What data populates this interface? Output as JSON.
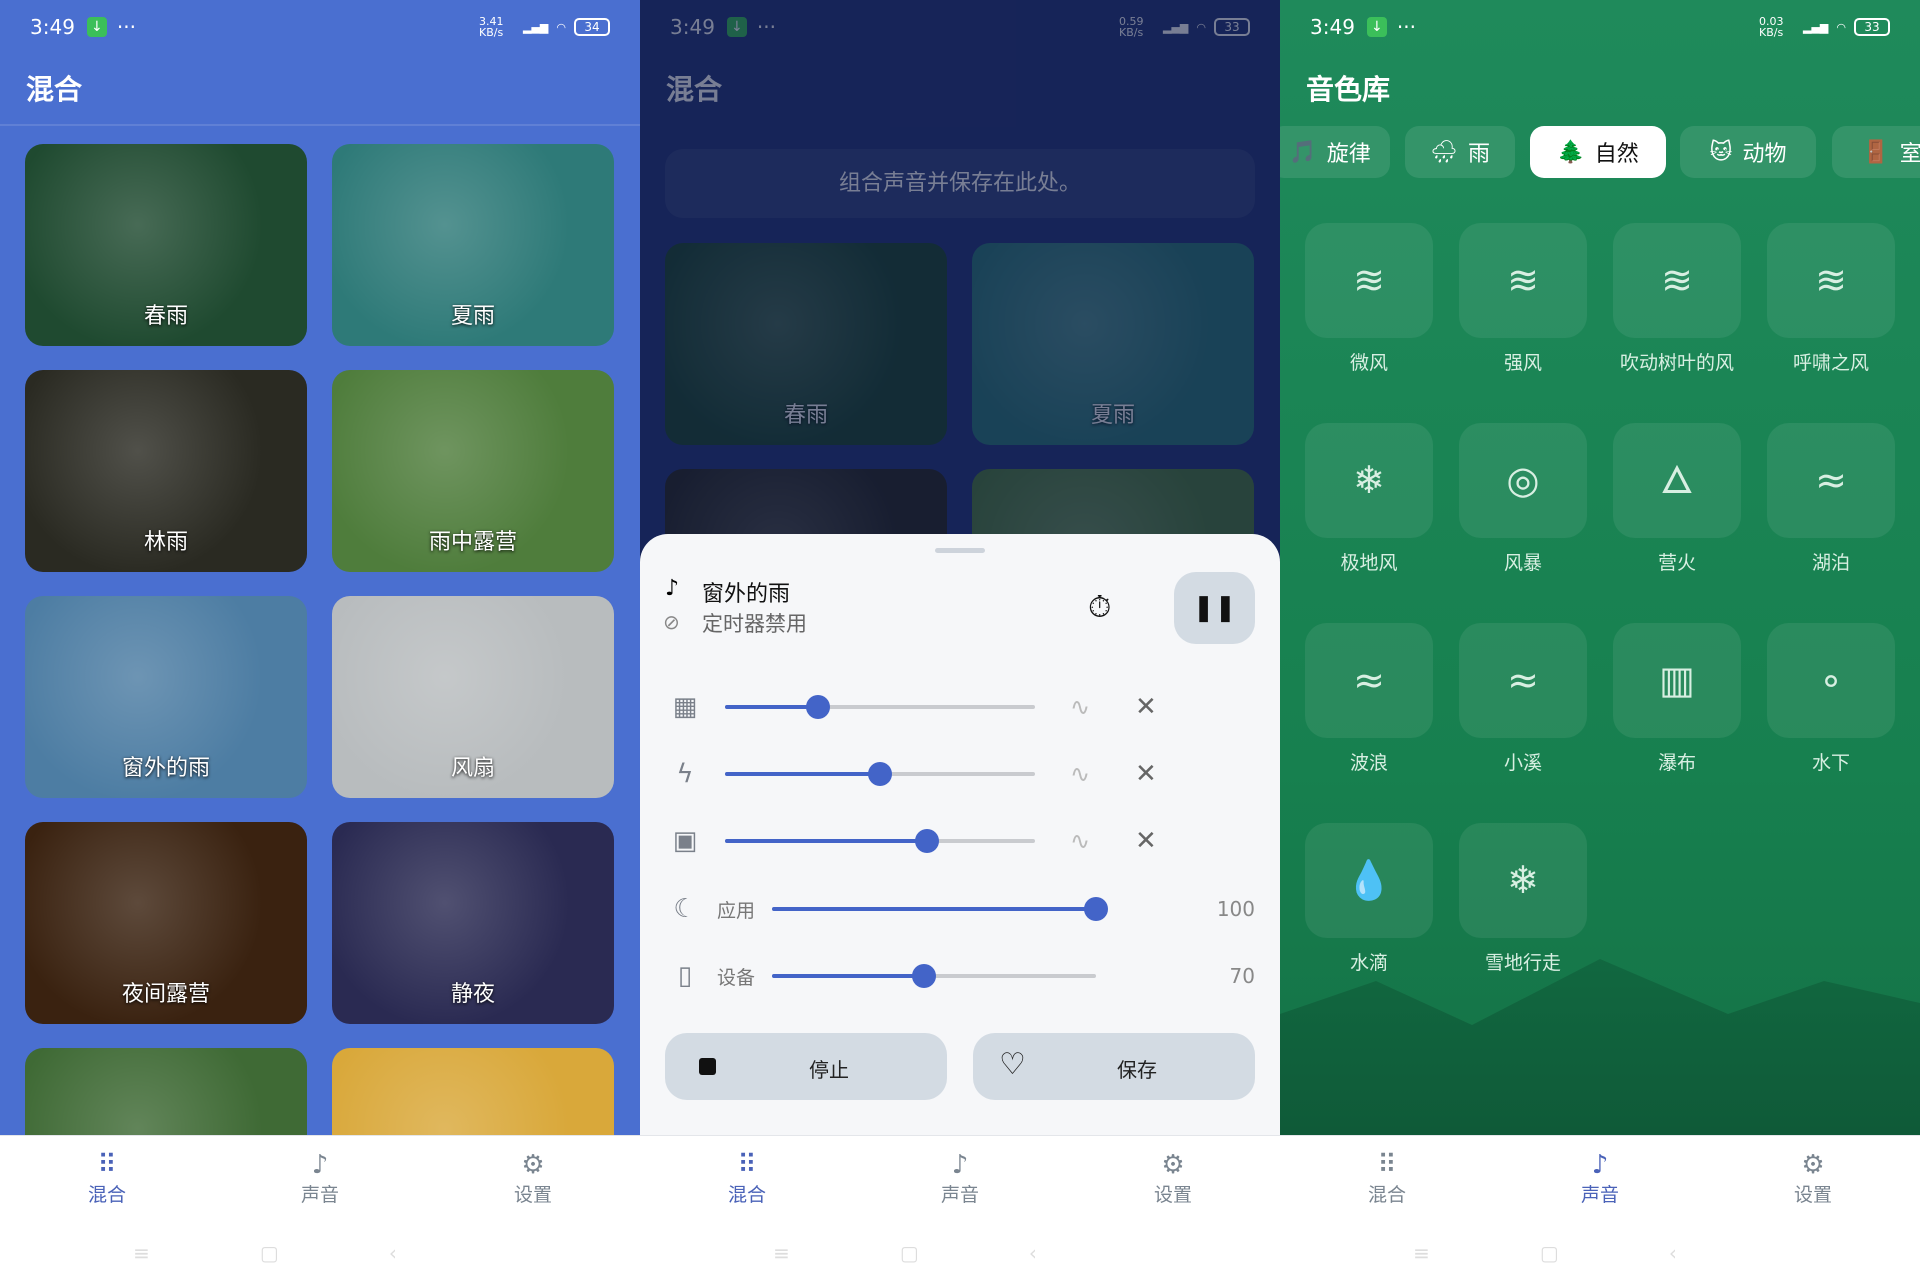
{
  "panel1": {
    "status": {
      "time": "3:49",
      "speed": "3.41 KB/s",
      "battery": "34"
    },
    "title": "混合",
    "cards": [
      {
        "label": "春雨",
        "bg": "#1f4a30"
      },
      {
        "label": "夏雨",
        "bg": "#2e7a78"
      },
      {
        "label": "林雨",
        "bg": "#2a2a22"
      },
      {
        "label": "雨中露营",
        "bg": "#4f7d3c"
      },
      {
        "label": "窗外的雨",
        "bg": "#4d7da3"
      },
      {
        "label": "风扇",
        "bg": "#b8bcbe"
      },
      {
        "label": "夜间露营",
        "bg": "#3a2210"
      },
      {
        "label": "静夜",
        "bg": "#2a2a52"
      },
      {
        "label": "",
        "bg": "#3f6a35"
      },
      {
        "label": "",
        "bg": "#d9a83a"
      }
    ]
  },
  "panel2": {
    "status": {
      "time": "3:49",
      "speed": "0.59 KB/s",
      "battery": "33"
    },
    "title": "混合",
    "placeholder": "组合声音并保存在此处。",
    "cards": [
      {
        "label": "春雨",
        "bg": "#1f4a30"
      },
      {
        "label": "夏雨",
        "bg": "#2e7a78"
      },
      {
        "label": "",
        "bg": "#2a2a22"
      },
      {
        "label": "",
        "bg": "#4f7d3c"
      }
    ],
    "sheet": {
      "title": "窗外的雨",
      "timer_status": "定时器禁用",
      "sounds": [
        {
          "icon": "window-icon",
          "glyph": "▦",
          "level": 0.3
        },
        {
          "icon": "lightning-icon",
          "glyph": "ϟ",
          "level": 0.5
        },
        {
          "icon": "fireplace-icon",
          "glyph": "▣",
          "level": 0.65
        }
      ],
      "app_volume": {
        "label": "应用",
        "value": "100",
        "level": 1.0
      },
      "device_volume": {
        "label": "设备",
        "value": "70",
        "level": 0.47
      },
      "stop_label": "停止",
      "save_label": "保存"
    }
  },
  "panel3": {
    "status": {
      "time": "3:49",
      "speed": "0.03 KB/s",
      "battery": "33"
    },
    "title": "音色库",
    "chips": [
      {
        "emoji": "🎵",
        "label": "旋律"
      },
      {
        "emoji": "🌧",
        "label": "雨"
      },
      {
        "emoji": "🌲",
        "label": "自然",
        "active": true
      },
      {
        "emoji": "🐱",
        "label": "动物"
      },
      {
        "emoji": "🚪",
        "label": "室"
      }
    ],
    "sounds": [
      {
        "label": "微风",
        "glyph": "≋"
      },
      {
        "label": "强风",
        "glyph": "≋"
      },
      {
        "label": "吹动树叶的风",
        "glyph": "≋"
      },
      {
        "label": "呼啸之风",
        "glyph": "≋"
      },
      {
        "label": "极地风",
        "glyph": "❄"
      },
      {
        "label": "风暴",
        "glyph": "◎"
      },
      {
        "label": "营火",
        "glyph": "🜂"
      },
      {
        "label": "湖泊",
        "glyph": "≈"
      },
      {
        "label": "波浪",
        "glyph": "≈"
      },
      {
        "label": "小溪",
        "glyph": "≈"
      },
      {
        "label": "瀑布",
        "glyph": "▥"
      },
      {
        "label": "水下",
        "glyph": "∘"
      },
      {
        "label": "水滴",
        "glyph": "💧"
      },
      {
        "label": "雪地行走",
        "glyph": "❄"
      }
    ]
  },
  "nav": [
    {
      "label": "混合",
      "icon": "grid-icon",
      "glyph": "⠿"
    },
    {
      "label": "声音",
      "icon": "music-note-icon",
      "glyph": "♪"
    },
    {
      "label": "设置",
      "icon": "gear-icon",
      "glyph": "⚙"
    }
  ],
  "colors": {
    "accent": "#4364c8",
    "mix_bg": "#4a6fd0",
    "library_bg": "#1f8a5b"
  }
}
